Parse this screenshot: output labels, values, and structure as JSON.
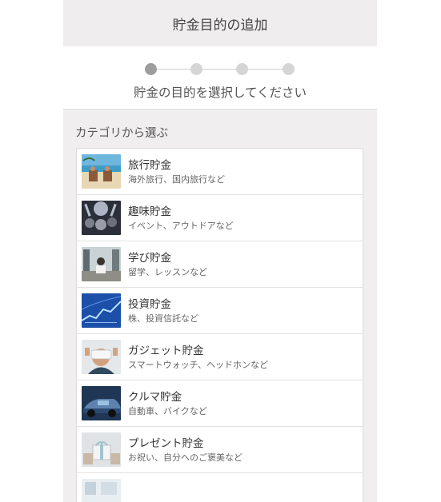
{
  "header": {
    "title": "貯金目的の追加"
  },
  "stepper": {
    "steps": 4,
    "current_step": 1,
    "caption": "貯金の目的を選択してください"
  },
  "section": {
    "title": "カテゴリから選ぶ"
  },
  "categories": [
    {
      "title": "旅行貯金",
      "subtitle": "海外旅行、国内旅行など",
      "icon": "beach-photo-icon"
    },
    {
      "title": "趣味貯金",
      "subtitle": "イベント、アウトドアなど",
      "icon": "concert-photo-icon"
    },
    {
      "title": "学び貯金",
      "subtitle": "留学、レッスンなど",
      "icon": "study-photo-icon"
    },
    {
      "title": "投資貯金",
      "subtitle": "株、投資信託など",
      "icon": "stock-chart-photo-icon"
    },
    {
      "title": "ガジェット貯金",
      "subtitle": "スマートウォッチ、ヘッドホンなど",
      "icon": "vr-headset-photo-icon"
    },
    {
      "title": "クルマ貯金",
      "subtitle": "自動車、バイクなど",
      "icon": "car-photo-icon"
    },
    {
      "title": "プレゼント貯金",
      "subtitle": "お祝い、自分へのご褒美など",
      "icon": "gift-photo-icon"
    },
    {
      "title": "",
      "subtitle": "",
      "icon": "interior-photo-icon"
    }
  ]
}
